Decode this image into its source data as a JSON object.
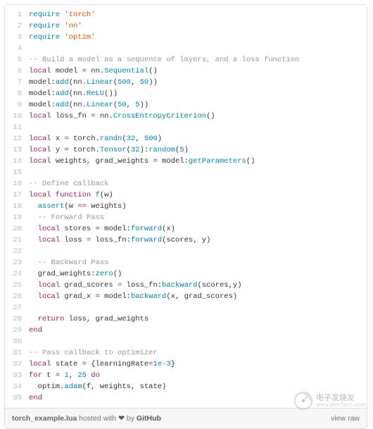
{
  "lines": [
    {
      "n": 1,
      "tokens": [
        [
          "kw-req",
          "require "
        ],
        [
          "str",
          "'torch'"
        ]
      ]
    },
    {
      "n": 2,
      "tokens": [
        [
          "kw-req",
          "require "
        ],
        [
          "str",
          "'nn'"
        ]
      ]
    },
    {
      "n": 3,
      "tokens": [
        [
          "kw-req",
          "require "
        ],
        [
          "str",
          "'optim'"
        ]
      ]
    },
    {
      "n": 4,
      "tokens": [
        [
          "id",
          ""
        ]
      ]
    },
    {
      "n": 5,
      "tokens": [
        [
          "cmt",
          "-- Build a model as a sequence of layers, and a loss function"
        ]
      ]
    },
    {
      "n": 6,
      "tokens": [
        [
          "kw",
          "local "
        ],
        [
          "id",
          "model "
        ],
        [
          "kw",
          "= "
        ],
        [
          "id",
          "nn."
        ],
        [
          "fn",
          "Sequential"
        ],
        [
          "id",
          "()"
        ]
      ]
    },
    {
      "n": 7,
      "tokens": [
        [
          "id",
          "model:"
        ],
        [
          "met",
          "add"
        ],
        [
          "id",
          "(nn."
        ],
        [
          "fn",
          "Linear"
        ],
        [
          "id",
          "("
        ],
        [
          "num",
          "500"
        ],
        [
          "id",
          ", "
        ],
        [
          "num",
          "50"
        ],
        [
          "id",
          "))"
        ]
      ]
    },
    {
      "n": 8,
      "tokens": [
        [
          "id",
          "model:"
        ],
        [
          "met",
          "add"
        ],
        [
          "id",
          "(nn."
        ],
        [
          "fn",
          "ReLU"
        ],
        [
          "id",
          "())"
        ]
      ]
    },
    {
      "n": 9,
      "tokens": [
        [
          "id",
          "model:"
        ],
        [
          "met",
          "add"
        ],
        [
          "id",
          "(nn."
        ],
        [
          "fn",
          "Linear"
        ],
        [
          "id",
          "("
        ],
        [
          "num",
          "50"
        ],
        [
          "id",
          ", "
        ],
        [
          "num",
          "5"
        ],
        [
          "id",
          "))"
        ]
      ]
    },
    {
      "n": 10,
      "tokens": [
        [
          "kw",
          "local "
        ],
        [
          "id",
          "loss_fn "
        ],
        [
          "kw",
          "= "
        ],
        [
          "id",
          "nn."
        ],
        [
          "fn",
          "CrossEntropyCriterion"
        ],
        [
          "id",
          "()"
        ]
      ]
    },
    {
      "n": 11,
      "tokens": [
        [
          "id",
          ""
        ]
      ]
    },
    {
      "n": 12,
      "tokens": [
        [
          "kw",
          "local "
        ],
        [
          "id",
          "x "
        ],
        [
          "kw",
          "= "
        ],
        [
          "id",
          "torch."
        ],
        [
          "fn",
          "randn"
        ],
        [
          "id",
          "("
        ],
        [
          "num",
          "32"
        ],
        [
          "id",
          ", "
        ],
        [
          "num",
          "500"
        ],
        [
          "id",
          ")"
        ]
      ]
    },
    {
      "n": 13,
      "tokens": [
        [
          "kw",
          "local "
        ],
        [
          "id",
          "y "
        ],
        [
          "kw",
          "= "
        ],
        [
          "id",
          "torch."
        ],
        [
          "fn",
          "Tensor"
        ],
        [
          "id",
          "("
        ],
        [
          "num",
          "32"
        ],
        [
          "id",
          "):"
        ],
        [
          "met",
          "random"
        ],
        [
          "id",
          "("
        ],
        [
          "num",
          "5"
        ],
        [
          "id",
          ")"
        ]
      ]
    },
    {
      "n": 14,
      "tokens": [
        [
          "kw",
          "local "
        ],
        [
          "id",
          "weights, grad_weights "
        ],
        [
          "kw",
          "= "
        ],
        [
          "id",
          "model:"
        ],
        [
          "met",
          "getParameters"
        ],
        [
          "id",
          "()"
        ]
      ]
    },
    {
      "n": 15,
      "tokens": [
        [
          "id",
          ""
        ]
      ]
    },
    {
      "n": 16,
      "tokens": [
        [
          "cmt",
          "-- Define callback"
        ]
      ]
    },
    {
      "n": 17,
      "tokens": [
        [
          "kw",
          "local function "
        ],
        [
          "fn",
          "f"
        ],
        [
          "id",
          "(w)"
        ]
      ]
    },
    {
      "n": 18,
      "tokens": [
        [
          "id",
          "  "
        ],
        [
          "fn",
          "assert"
        ],
        [
          "id",
          "(w "
        ],
        [
          "kw",
          "=="
        ],
        [
          "id",
          " weights)"
        ]
      ]
    },
    {
      "n": 19,
      "tokens": [
        [
          "id",
          "  "
        ],
        [
          "cmt",
          "-- Forward Pass"
        ]
      ]
    },
    {
      "n": 20,
      "tokens": [
        [
          "id",
          "  "
        ],
        [
          "kw",
          "local "
        ],
        [
          "id",
          "stores "
        ],
        [
          "kw",
          "= "
        ],
        [
          "id",
          "model:"
        ],
        [
          "met",
          "forward"
        ],
        [
          "id",
          "(x)"
        ]
      ]
    },
    {
      "n": 21,
      "tokens": [
        [
          "id",
          "  "
        ],
        [
          "kw",
          "local "
        ],
        [
          "id",
          "loss "
        ],
        [
          "kw",
          "= "
        ],
        [
          "id",
          "loss_fn:"
        ],
        [
          "met",
          "forward"
        ],
        [
          "id",
          "(scores, y)"
        ]
      ]
    },
    {
      "n": 22,
      "tokens": [
        [
          "id",
          ""
        ]
      ]
    },
    {
      "n": 23,
      "tokens": [
        [
          "id",
          "  "
        ],
        [
          "cmt",
          "-- Backward Pass"
        ]
      ]
    },
    {
      "n": 24,
      "tokens": [
        [
          "id",
          "  grad_weights:"
        ],
        [
          "met",
          "zero"
        ],
        [
          "id",
          "()"
        ]
      ]
    },
    {
      "n": 25,
      "tokens": [
        [
          "id",
          "  "
        ],
        [
          "kw",
          "local "
        ],
        [
          "id",
          "grad_scores "
        ],
        [
          "kw",
          "= "
        ],
        [
          "id",
          "loss_fn:"
        ],
        [
          "met",
          "backward"
        ],
        [
          "id",
          "(scores,y)"
        ]
      ]
    },
    {
      "n": 26,
      "tokens": [
        [
          "id",
          "  "
        ],
        [
          "kw",
          "local "
        ],
        [
          "id",
          "grad_x "
        ],
        [
          "kw",
          "= "
        ],
        [
          "id",
          "model:"
        ],
        [
          "met",
          "backward"
        ],
        [
          "id",
          "(x, grad_scores)"
        ]
      ]
    },
    {
      "n": 27,
      "tokens": [
        [
          "id",
          ""
        ]
      ]
    },
    {
      "n": 28,
      "tokens": [
        [
          "id",
          "  "
        ],
        [
          "kw",
          "return "
        ],
        [
          "id",
          "loss, grad_weights"
        ]
      ]
    },
    {
      "n": 29,
      "tokens": [
        [
          "kw",
          "end"
        ]
      ]
    },
    {
      "n": 30,
      "tokens": [
        [
          "id",
          ""
        ]
      ]
    },
    {
      "n": 31,
      "tokens": [
        [
          "cmt",
          "-- Pass callback to optimizer"
        ]
      ]
    },
    {
      "n": 32,
      "tokens": [
        [
          "kw",
          "local "
        ],
        [
          "id",
          "state "
        ],
        [
          "kw",
          "= "
        ],
        [
          "id",
          "{learningRate"
        ],
        [
          "kw",
          "="
        ],
        [
          "num",
          "1e-3"
        ],
        [
          "id",
          "}"
        ]
      ]
    },
    {
      "n": 33,
      "tokens": [
        [
          "kw",
          "for "
        ],
        [
          "id",
          "t "
        ],
        [
          "kw",
          "= "
        ],
        [
          "num",
          "1"
        ],
        [
          "id",
          ", "
        ],
        [
          "num",
          "25"
        ],
        [
          "kw",
          " do"
        ]
      ]
    },
    {
      "n": 34,
      "tokens": [
        [
          "id",
          "  optim."
        ],
        [
          "fn",
          "adam"
        ],
        [
          "id",
          "(f, weights, state)"
        ]
      ]
    },
    {
      "n": 35,
      "tokens": [
        [
          "kw",
          "end"
        ]
      ]
    }
  ],
  "footer": {
    "filename": "torch_example.lua",
    "hosted_prefix": " hosted with ",
    "heart": "❤",
    "by": " by ",
    "github": "GitHub",
    "view_raw": "view raw"
  },
  "watermark": {
    "brand": "电子发烧友",
    "url": "www.elecfans.com"
  }
}
